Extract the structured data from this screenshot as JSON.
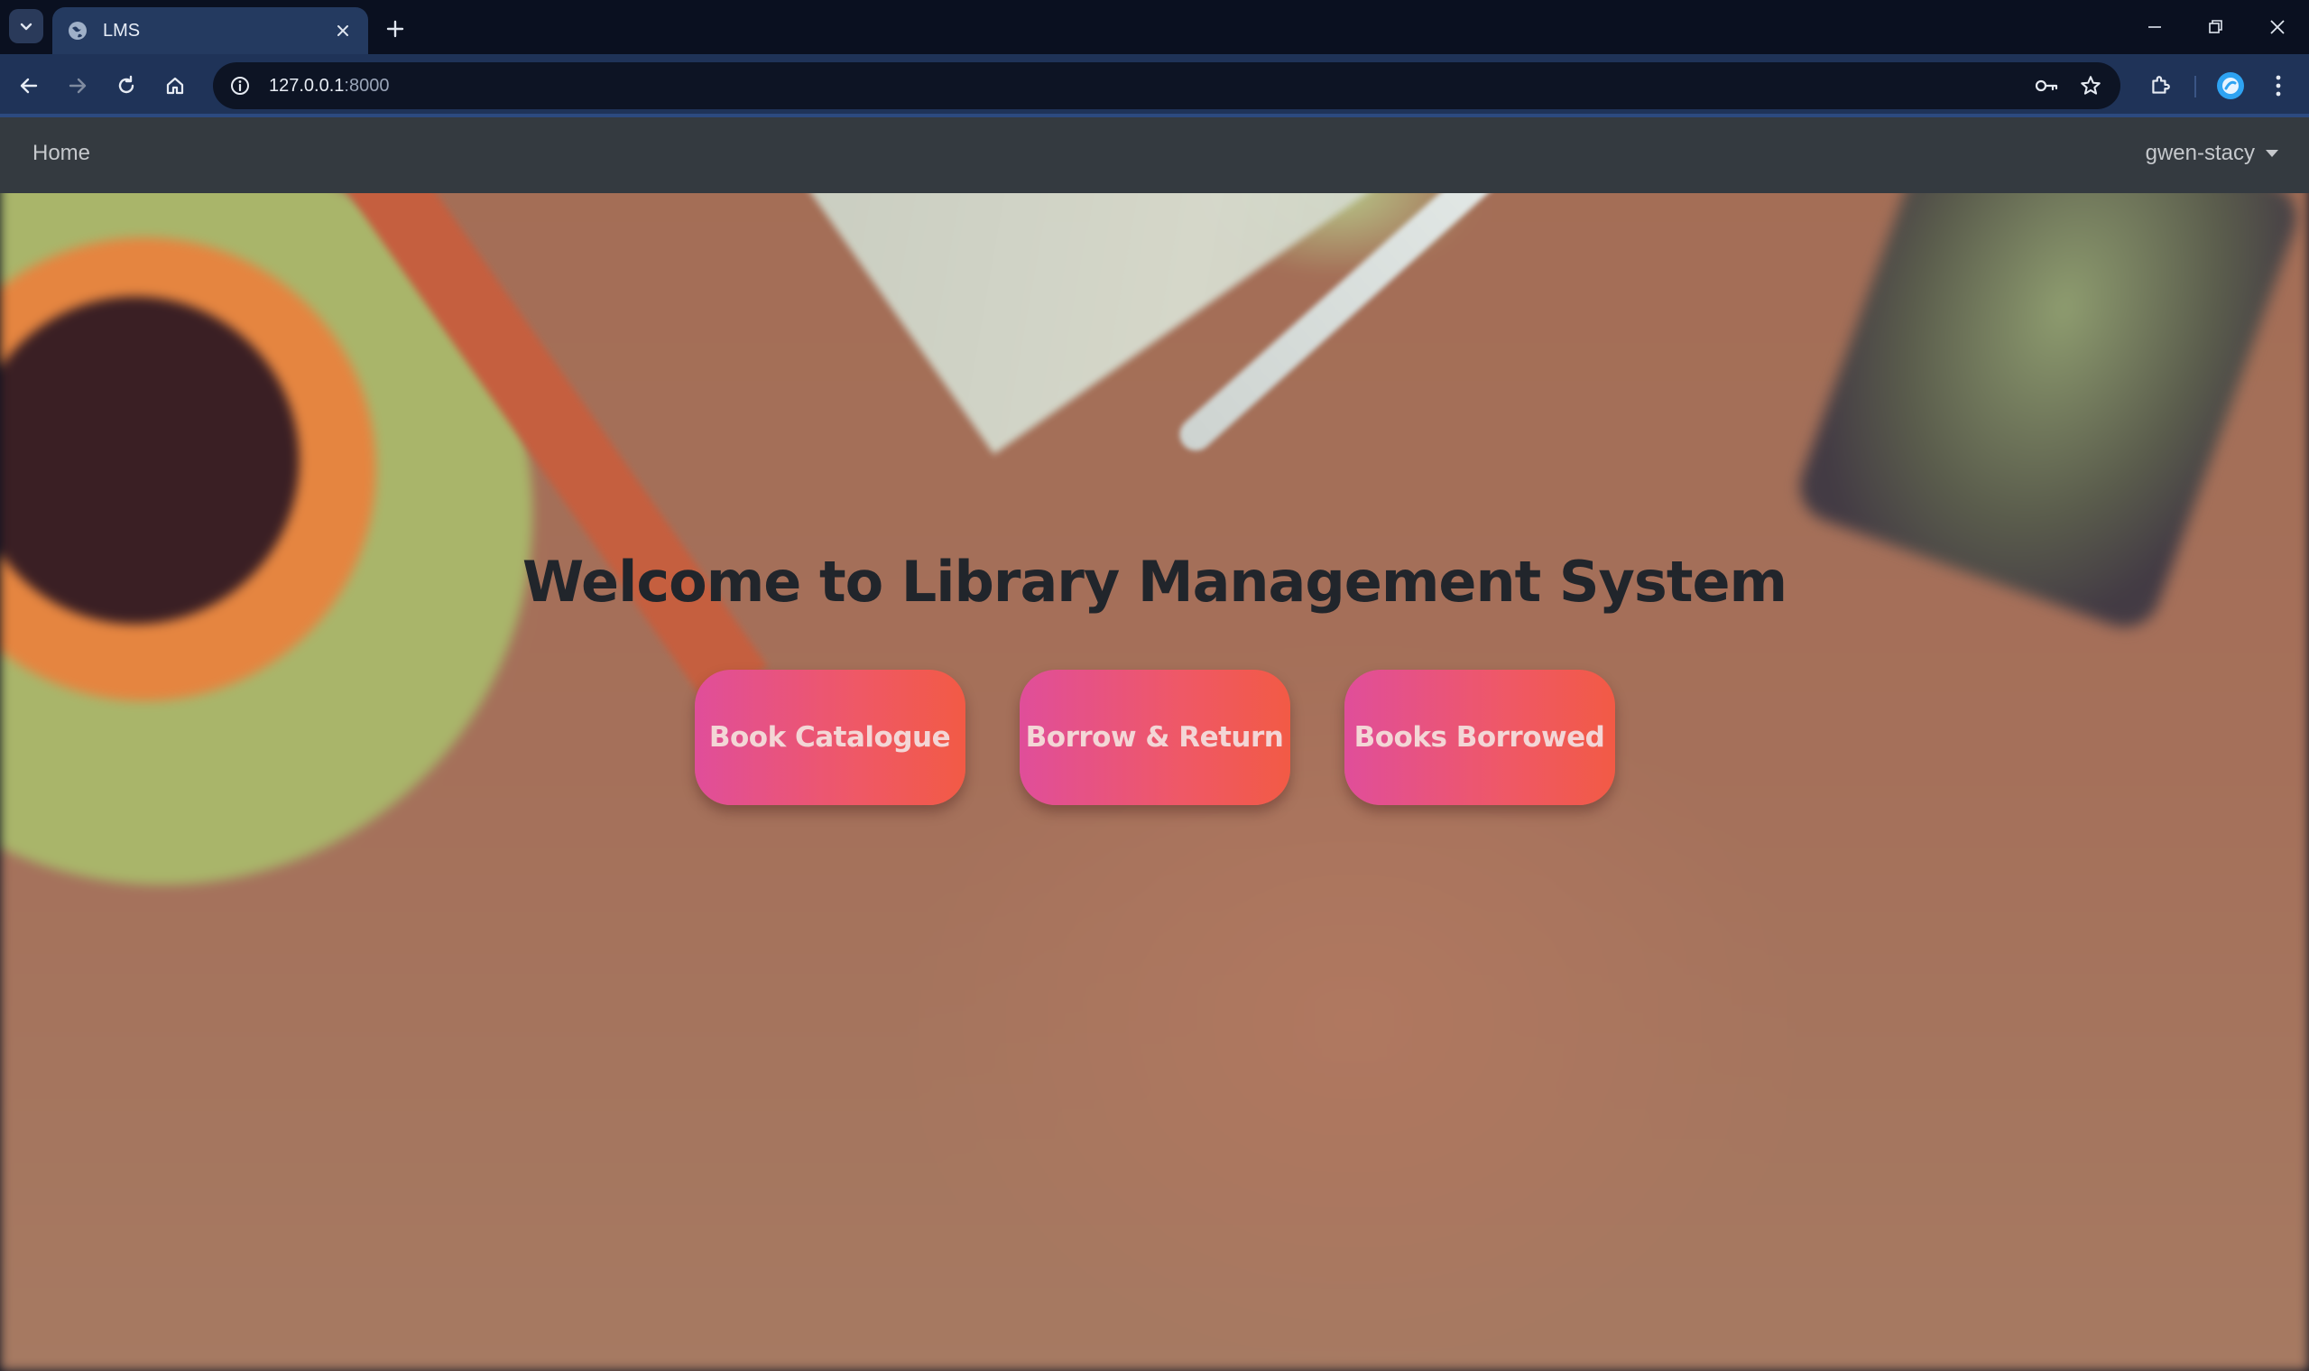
{
  "browser": {
    "tab_title": "LMS",
    "url_host": "127.0.0.1",
    "url_port": ":8000",
    "accent_color": "#243a60"
  },
  "icons": {
    "tab_search": "chevron-down-icon",
    "favicon": "globe-icon",
    "tab_close": "close-icon",
    "new_tab": "plus-icon",
    "back": "arrow-left-icon",
    "forward": "arrow-right-icon",
    "reload": "reload-icon",
    "home": "home-icon",
    "site_info": "info-icon",
    "password": "key-icon",
    "bookmark": "star-icon",
    "extensions": "puzzle-icon",
    "profile": "profile-icon",
    "menu": "more-vert-icon"
  },
  "navbar": {
    "home_label": "Home",
    "user_label": "gwen-stacy"
  },
  "hero": {
    "title": "Welcome to Library Management System",
    "buttons": [
      {
        "label": "Book Catalogue"
      },
      {
        "label": "Borrow & Return"
      },
      {
        "label": "Books Borrowed"
      }
    ]
  },
  "colors": {
    "navbar_bg": "#343a40",
    "button_gradient_start": "#e04e9a",
    "button_gradient_end": "#f25a45",
    "title_color": "#21252b"
  }
}
